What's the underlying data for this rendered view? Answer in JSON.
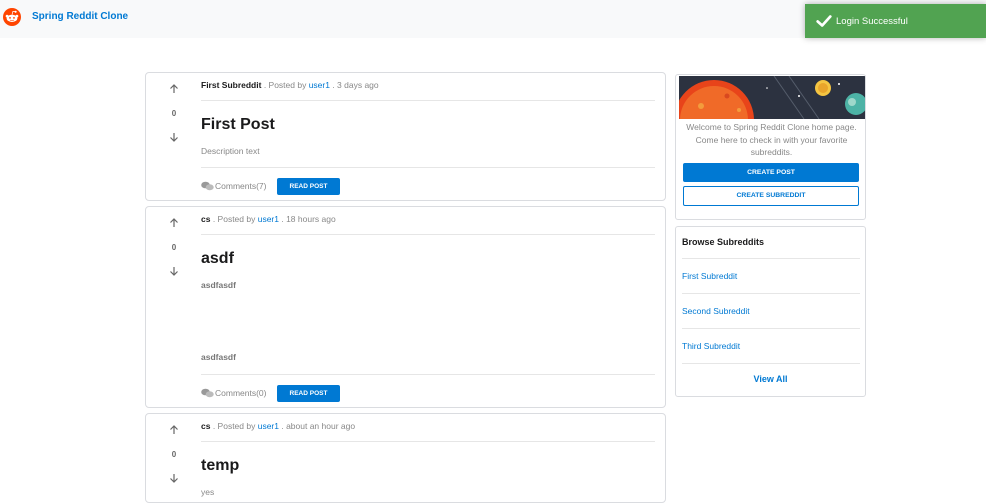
{
  "header": {
    "brand": "Spring Reddit Clone",
    "logo_icon": "reddit-alien-icon",
    "brand_color": "#0079d3",
    "logo_color": "#ff4500"
  },
  "toast": {
    "message": "Login Successful",
    "icon": "check-icon",
    "color": "#51a351"
  },
  "posts": [
    {
      "vote_count": "0",
      "subreddit": "First Subreddit",
      "posted_by_prefix": " . Posted by ",
      "user": "user1",
      "time": " . 3 days ago",
      "title": "First Post",
      "description": "Description text",
      "comments_label": "Comments(7)",
      "read_label": "READ POST"
    },
    {
      "vote_count": "0",
      "subreddit": "cs",
      "posted_by_prefix": " . Posted by ",
      "user": "user1",
      "time": " . 18 hours ago",
      "title": "asdf",
      "description_line1": "asdfasdf",
      "description_line2": "asdfasdf",
      "comments_label": "Comments(0)",
      "read_label": "READ POST"
    },
    {
      "vote_count": "0",
      "subreddit": "cs",
      "posted_by_prefix": " . Posted by ",
      "user": "user1",
      "time": " . about an hour ago",
      "title": "temp",
      "description": "yes"
    }
  ],
  "sidebar": {
    "welcome_text": "Welcome to Spring Reddit Clone home page. Come here to check in with your favorite subreddits.",
    "create_post_label": "CREATE POST",
    "create_subreddit_label": "CREATE SUBREDDIT",
    "browse_title": "Browse Subreddits",
    "subreddits": [
      "First Subreddit",
      "Second Subreddit",
      "Third Subreddit"
    ],
    "view_all_label": "View All"
  }
}
